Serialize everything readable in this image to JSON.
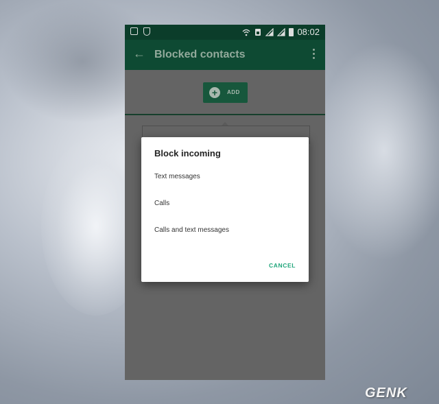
{
  "status_bar": {
    "time": "08:02",
    "icons": [
      "gallery-icon",
      "shield-icon",
      "wifi-icon",
      "sim-icon",
      "signal-icon",
      "signal-icon",
      "battery-icon"
    ]
  },
  "app_bar": {
    "title": "Blocked contacts",
    "back_icon": "arrow-back-icon",
    "menu_icon": "more-vert-icon"
  },
  "add_button": {
    "label": "ADD",
    "icon": "plus-circle-icon"
  },
  "dialog": {
    "title": "Block incoming",
    "options": [
      "Text messages",
      "Calls",
      "Calls and text messages"
    ],
    "cancel_label": "CANCEL"
  },
  "watermark": "GENK",
  "colors": {
    "status_bar": "#0b3d2a",
    "app_bar": "#0e4a33",
    "accent": "#1fa57a",
    "scrim": "#646464"
  }
}
